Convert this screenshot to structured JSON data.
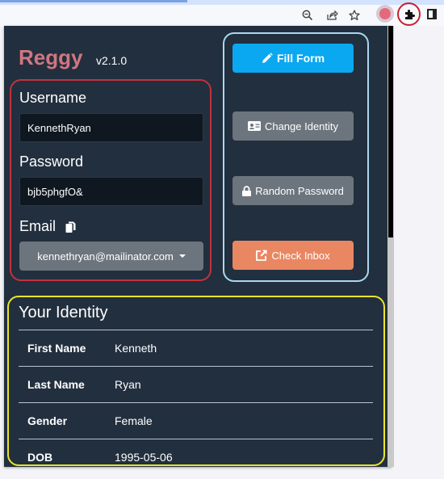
{
  "browser": {
    "toolbar_icons": [
      "zoom-out-icon",
      "share-icon",
      "bookmark-star-icon",
      "extension-avatar-icon",
      "extensions-puzzle-icon",
      "side-panel-icon"
    ]
  },
  "popup": {
    "app_name": "Reggy",
    "version": "v2.1.0",
    "credentials": {
      "username_label": "Username",
      "username_value": "KennethRyan",
      "password_label": "Password",
      "password_value": "bjb5phgfO&",
      "email_label": "Email",
      "email_value": "kennethryan@mailinator.com"
    },
    "actions": {
      "fill_form": "Fill Form",
      "change_identity": "Change Identity",
      "random_password": "Random Password",
      "check_inbox": "Check Inbox"
    },
    "identity": {
      "title": "Your Identity",
      "rows": [
        {
          "label": "First Name",
          "value": "Kenneth"
        },
        {
          "label": "Last Name",
          "value": "Ryan"
        },
        {
          "label": "Gender",
          "value": "Female"
        },
        {
          "label": "DOB",
          "value": "1995-05-06"
        }
      ]
    }
  },
  "colors": {
    "title": "#d1767f",
    "popup_bg": "#222f3e",
    "fill_form": "#0aa8f0",
    "gray_button": "#6c757d",
    "check_inbox": "#e98762",
    "credentials_border": "#c2323d",
    "actions_border": "#a9d8ef",
    "identity_border": "#e8e52a"
  }
}
